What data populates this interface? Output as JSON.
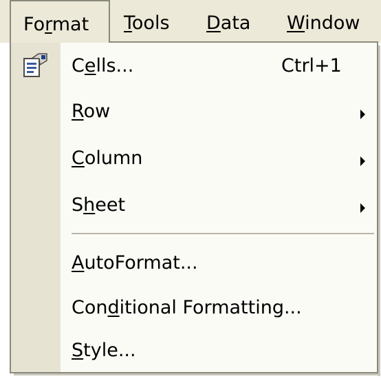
{
  "menubar": {
    "items": [
      {
        "pre": "Fo",
        "ul": "r",
        "post": "mat"
      },
      {
        "pre": "",
        "ul": "T",
        "post": "ools"
      },
      {
        "pre": "",
        "ul": "D",
        "post": "ata"
      },
      {
        "pre": "",
        "ul": "W",
        "post": "indow"
      }
    ]
  },
  "dropdown": {
    "items": [
      {
        "pre": "C",
        "ul": "e",
        "post": "lls...",
        "shortcut": "Ctrl+1",
        "icon": "format-cells-icon"
      },
      {
        "pre": "",
        "ul": "R",
        "post": "ow",
        "submenu": true
      },
      {
        "pre": "",
        "ul": "C",
        "post": "olumn",
        "submenu": true
      },
      {
        "pre": "S",
        "ul": "h",
        "post": "eet",
        "submenu": true
      },
      {
        "pre": "",
        "ul": "A",
        "post": "utoFormat..."
      },
      {
        "pre": "Con",
        "ul": "d",
        "post": "itional Formatting..."
      },
      {
        "pre": "",
        "ul": "S",
        "post": "tyle..."
      }
    ]
  },
  "colors": {
    "menubar_bg": "#ece9d8",
    "menu_bg": "#fbfbf6",
    "gutter_bg": "#e6e3d2",
    "border": "#8a8a7c"
  }
}
